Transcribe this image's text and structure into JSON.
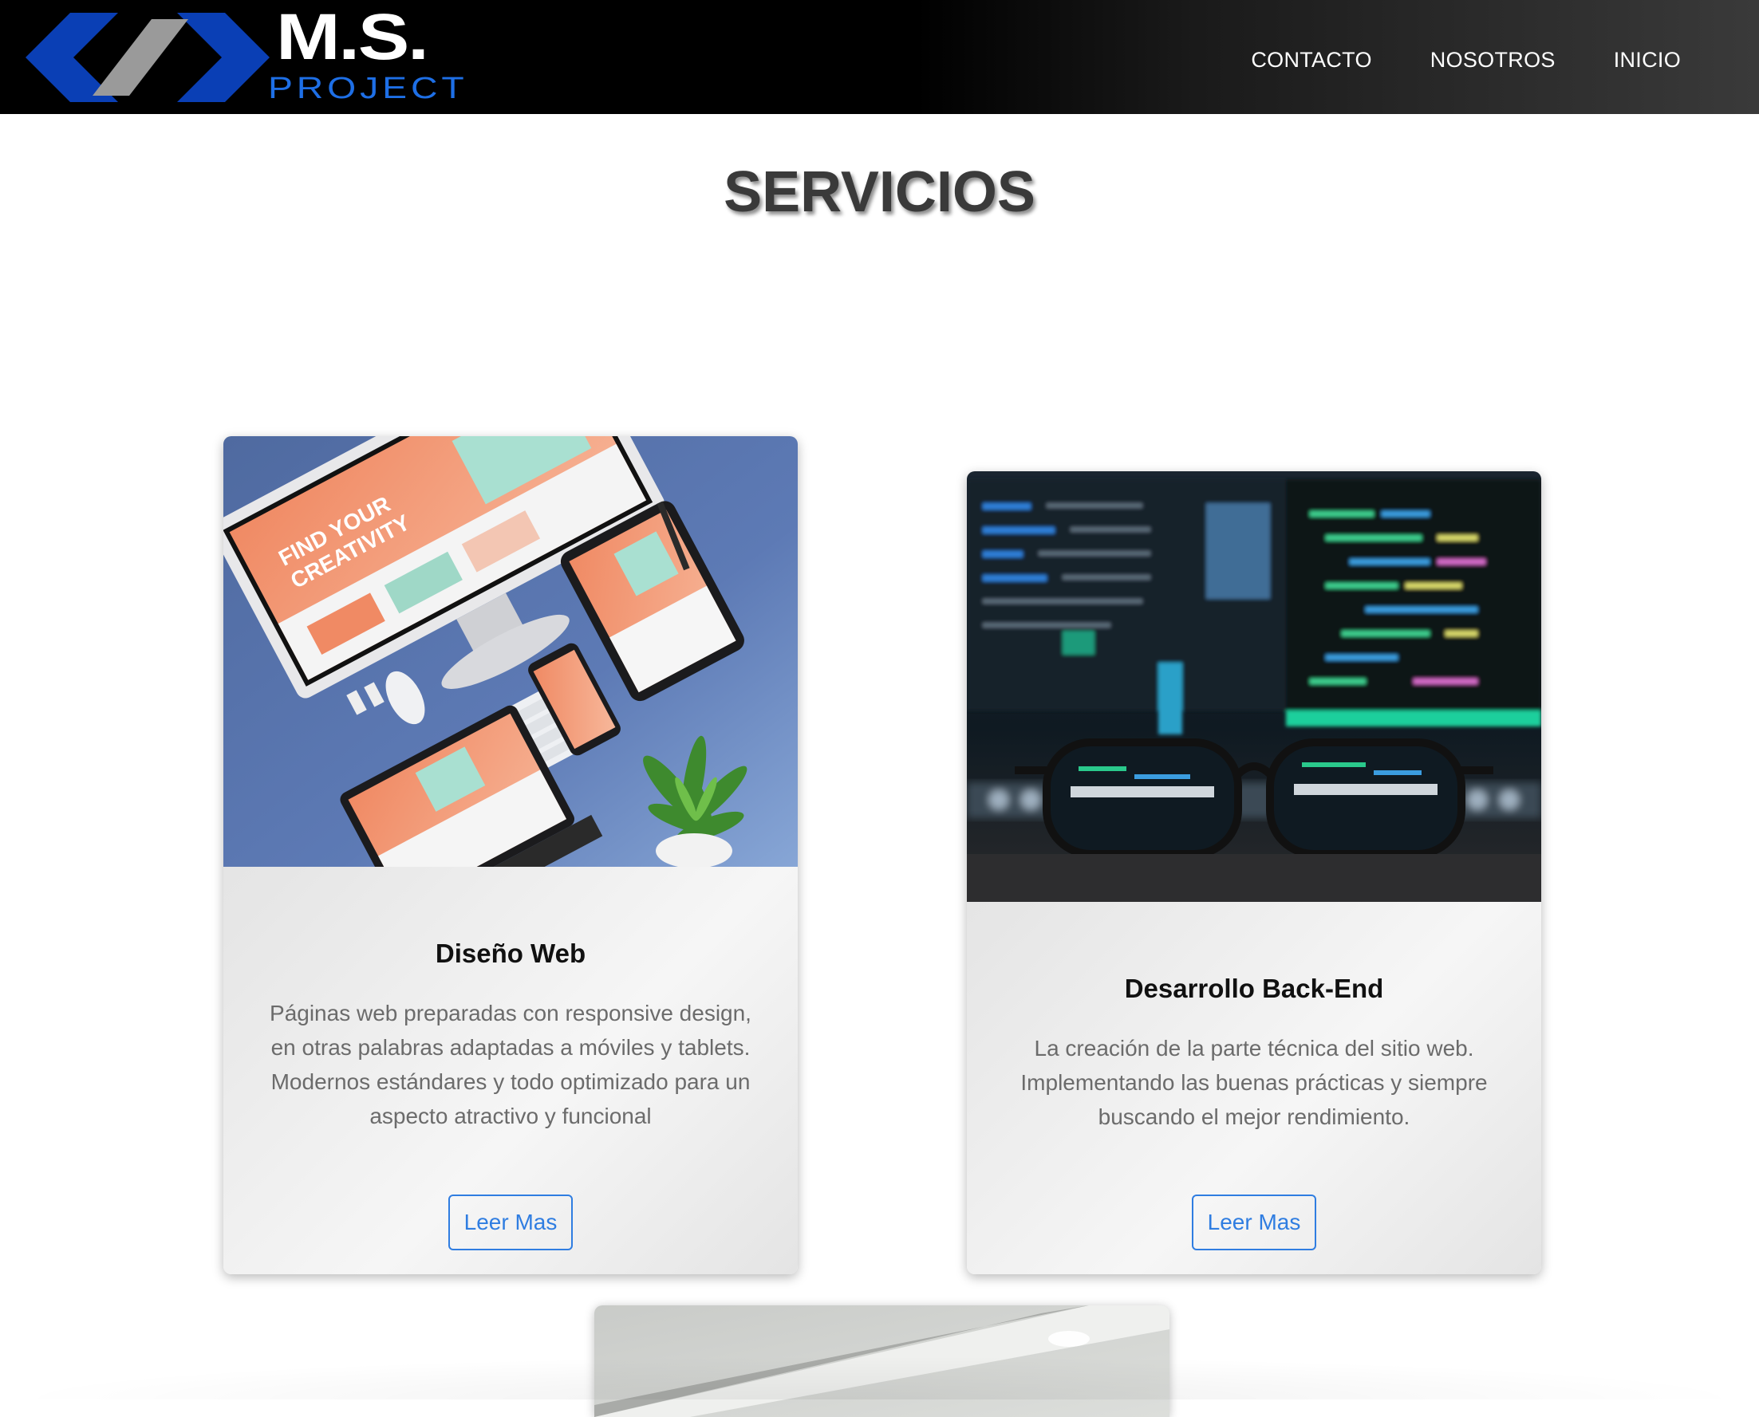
{
  "brand": {
    "logo_main": "M.S.",
    "logo_sub": "PROJECT",
    "colors": {
      "blue": "#0a3fb5",
      "gray": "#9a9a9a",
      "project_blue": "#1e6fe6"
    }
  },
  "nav": {
    "items": [
      {
        "label": "CONTACTO"
      },
      {
        "label": "NOSOTROS"
      },
      {
        "label": "INICIO"
      }
    ]
  },
  "main": {
    "title": "SERVICIOS",
    "cards": [
      {
        "title": "Diseño Web",
        "text": "Páginas web preparadas con responsive design, en otras palabras adaptadas a móviles y tablets. Modernos estándares y todo optimizado para un aspecto atractivo y funcional",
        "button": "Leer Mas",
        "image": "devices-mockup-photo"
      },
      {
        "title": "Desarrollo Back-End",
        "text": "La creación de la parte técnica del sitio web. Implementando las buenas prácticas y siempre buscando el mejor rendimiento.",
        "button": "Leer Mas",
        "image": "code-screen-glasses-photo"
      },
      {
        "image": "laptop-photo"
      }
    ]
  },
  "theme": {
    "accent": "#2f7de1",
    "title_color": "#3a3a3a",
    "body_text": "#6b6b6b"
  }
}
